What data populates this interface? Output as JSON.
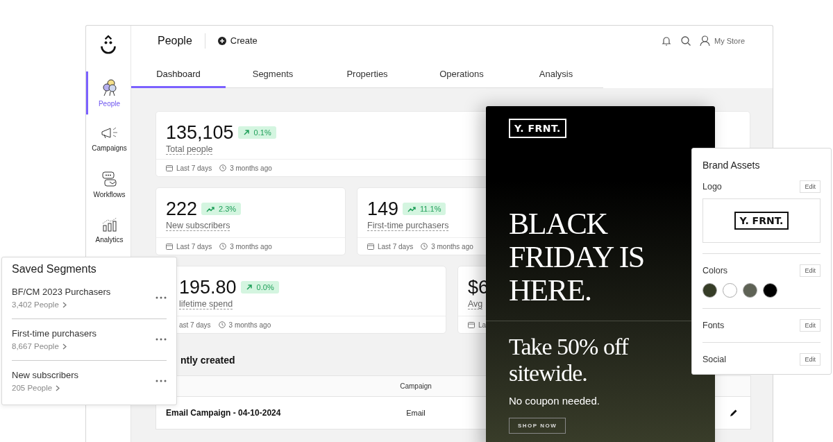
{
  "sidebar": {
    "items": [
      {
        "label": "People",
        "selected": true
      },
      {
        "label": "Campaigns",
        "selected": false
      },
      {
        "label": "Workflows",
        "selected": false
      },
      {
        "label": "Analytics",
        "selected": false
      }
    ]
  },
  "topbar": {
    "title": "People",
    "create": "Create",
    "account": "My Store"
  },
  "tabs": [
    {
      "label": "Dashboard",
      "selected": true
    },
    {
      "label": "Segments",
      "selected": false
    },
    {
      "label": "Properties",
      "selected": false
    },
    {
      "label": "Operations",
      "selected": false
    },
    {
      "label": "Analysis",
      "selected": false
    }
  ],
  "stat_rows": [
    {
      "cards": [
        {
          "value": "135,105",
          "badge": {
            "kind": "arrow",
            "text": "0.1%"
          },
          "label": "Total people",
          "period": "Last 7 days",
          "updated": "3 months ago"
        }
      ]
    },
    {
      "cards": [
        {
          "value": "222",
          "badge": {
            "kind": "trend",
            "text": "2.3%"
          },
          "label": "New subscribers",
          "period": "Last 7 days",
          "updated": "3 months ago"
        },
        {
          "value": "149",
          "badge": {
            "kind": "trend",
            "text": "11.1%"
          },
          "label": "First-time purchasers",
          "period": "Last 7 days",
          "updated": "3 months ago"
        }
      ]
    },
    {
      "cards": [
        {
          "value": "195.80",
          "badge": {
            "kind": "arrow",
            "text": "0.0%"
          },
          "label": "lifetime spend",
          "period": "ast 7 days",
          "updated": "3 months ago"
        },
        {
          "value": "$6",
          "label": "Avg",
          "period": "La"
        }
      ]
    }
  ],
  "recent": {
    "heading": "ntly created",
    "columns": [
      "",
      "Campaign"
    ],
    "rows": [
      {
        "cells": [
          "Email Campaign - 04-10-2024",
          "Email"
        ]
      }
    ]
  },
  "saved_segments": {
    "title": "Saved Segments",
    "items": [
      {
        "name": "BF/CM 2023 Purchasers",
        "count": "3,402 People"
      },
      {
        "name": "First-time purchasers",
        "count": "8,667 People"
      },
      {
        "name": "New subscribers",
        "count": "205 People"
      }
    ]
  },
  "email": {
    "logo": "Y. FRNT.",
    "headline": "BLACK FRIDAY IS HERE.",
    "offer": "Take 50% off sitewide.",
    "note": "No coupon needed.",
    "cta": "SHOP NOW"
  },
  "brand_assets": {
    "title": "Brand Assets",
    "logo": "Y. FRNT.",
    "sections": [
      {
        "label": "Logo",
        "action": "Edit",
        "kind": "logo"
      },
      {
        "label": "Colors",
        "action": "Edit",
        "kind": "colors"
      },
      {
        "label": "Fonts",
        "action": "Edit",
        "kind": "plain"
      },
      {
        "label": "Social",
        "action": "Edit",
        "kind": "plain"
      }
    ],
    "colors": [
      {
        "color": "#363d27"
      },
      {
        "color": "#ffffff"
      },
      {
        "color": "#5e6255"
      },
      {
        "color": "#000000"
      }
    ]
  }
}
